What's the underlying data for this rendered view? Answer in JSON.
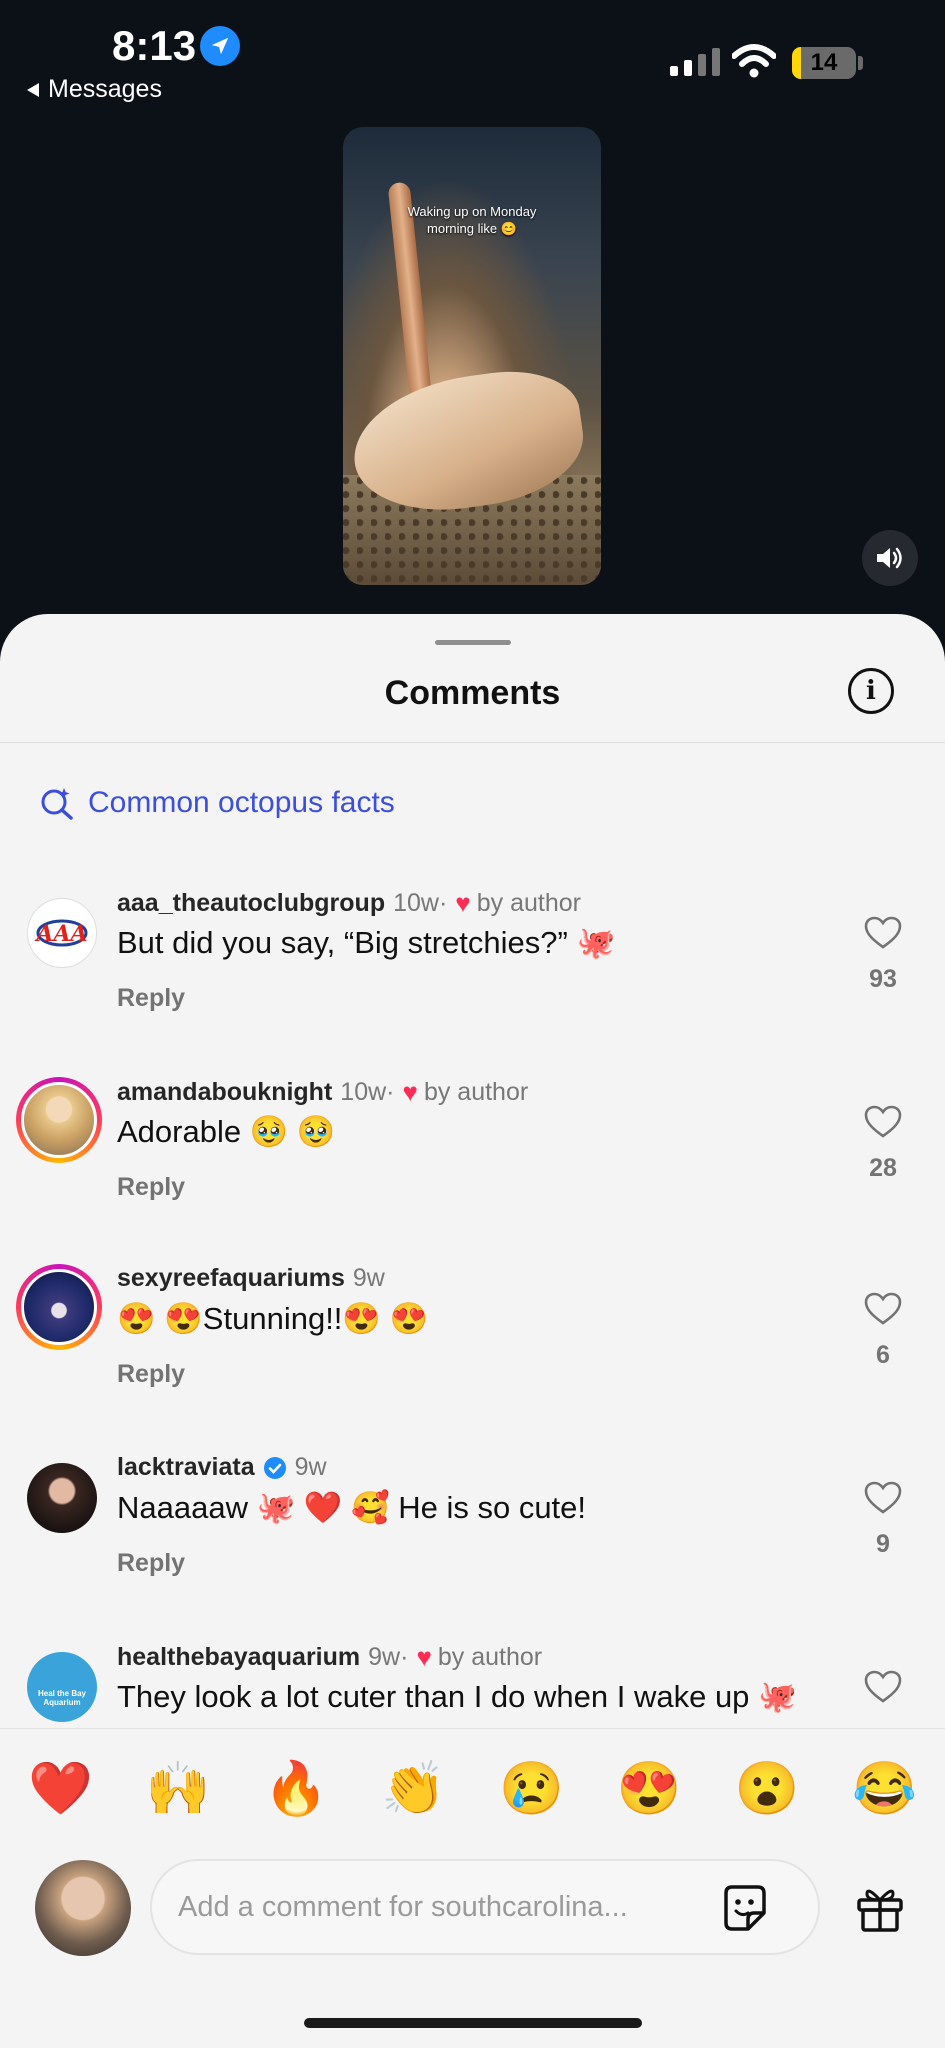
{
  "status_bar": {
    "time": "8:13",
    "back_label": "Messages",
    "battery": "14",
    "battery_level": 0.14
  },
  "video": {
    "caption_line1": "Waking up on Monday",
    "caption_line2": "morning like 😊"
  },
  "sheet": {
    "title": "Comments"
  },
  "suggestion": {
    "label": "Common octopus facts"
  },
  "comments": [
    {
      "username": "aaa_theautoclubgroup",
      "time": "10w",
      "liked_by": "by author",
      "text": "But did you say, “Big stretchies?” 🐙",
      "reply": "Reply",
      "likes": "93",
      "avatar": "aaa"
    },
    {
      "username": "amandabouknight",
      "time": "10w",
      "liked_by": "by author",
      "text": "Adorable 🥹 🥹",
      "reply": "Reply",
      "likes": "28",
      "avatar": "blonde-woman"
    },
    {
      "username": "sexyreefaquariums",
      "time": "9w",
      "liked_by": "",
      "text": "😍 😍Stunning!!😍 😍",
      "reply": "Reply",
      "likes": "6",
      "avatar": "aquarium-person"
    },
    {
      "username": "lacktraviata",
      "time": "9w",
      "liked_by": "",
      "verified": true,
      "text": "Naaaaaw 🐙 ❤️ 🥰 He is so cute!",
      "reply": "Reply",
      "likes": "9",
      "avatar": "dark-hair-woman"
    },
    {
      "username": "healthebayaquarium",
      "time": "9w",
      "liked_by": "by author",
      "text": "They look a lot cuter than I do when I wake up 🐙",
      "reply": "",
      "likes": "",
      "avatar": "heal-the-bay-logo",
      "avatar_text": "Heal the Bay Aquarium"
    }
  ],
  "quick_reactions": [
    "❤️",
    "🙌",
    "🔥",
    "👏",
    "😢",
    "😍",
    "😮",
    "😂"
  ],
  "composer": {
    "placeholder": "Add a comment for southcarolina..."
  },
  "colors": {
    "accent": "#3b4ee0",
    "heart": "#ff2d55",
    "sheet_bg": "#f4f4f4",
    "video_bg": "#0c1017"
  }
}
